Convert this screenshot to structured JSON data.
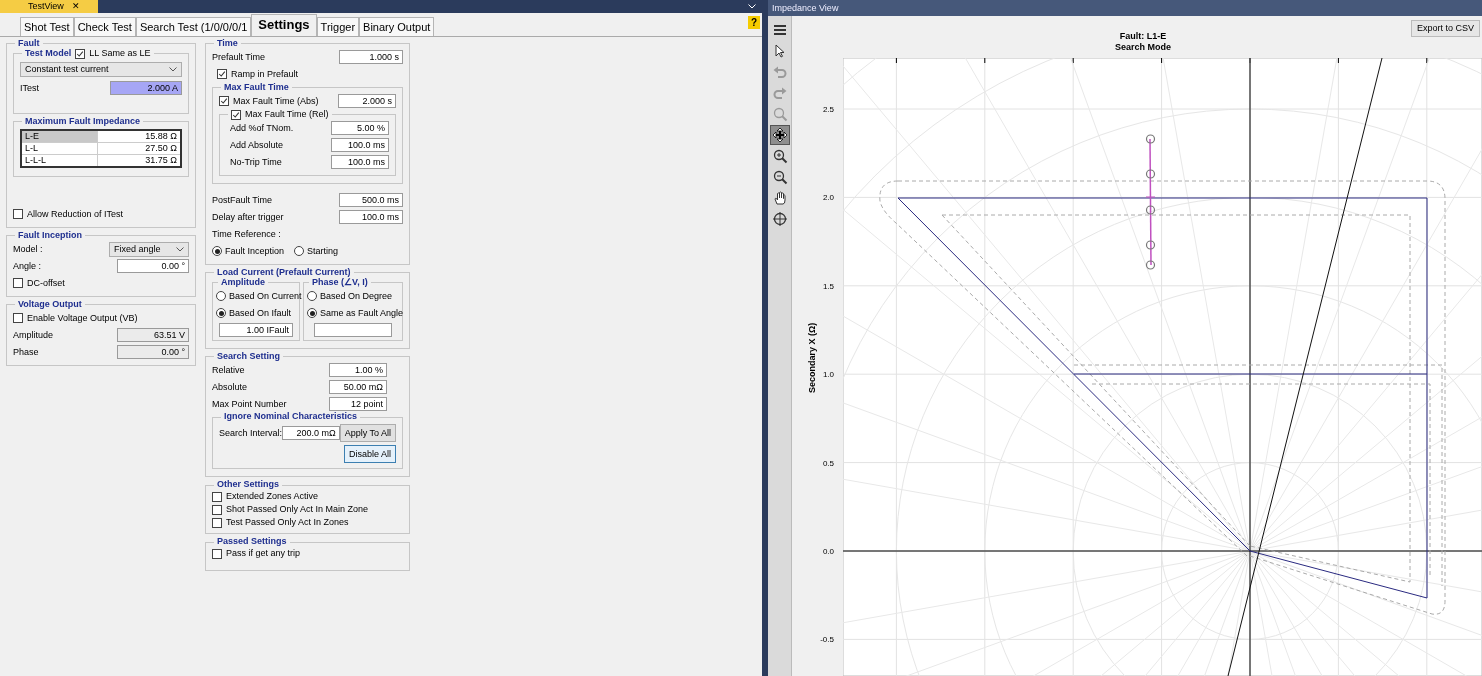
{
  "document_tab": {
    "title": "TestView",
    "close": "✕"
  },
  "tabs": [
    {
      "label": "Shot Test",
      "selected": false
    },
    {
      "label": "Check Test",
      "selected": false
    },
    {
      "label": "Search Test (1/0/0/0/1",
      "selected": false
    },
    {
      "label": "Settings",
      "selected": true
    },
    {
      "label": "Trigger",
      "selected": false
    },
    {
      "label": "Binary Output",
      "selected": false
    }
  ],
  "help": "?",
  "fault": {
    "title": "Fault",
    "test_model": {
      "title": "Test Model",
      "ll_same_as_le": {
        "label": "LL Same as LE",
        "checked": true
      },
      "mode": "Constant test current",
      "itest_label": "ITest",
      "itest": {
        "value": "2.000 A",
        "highlighted": true
      }
    },
    "max_impedance": {
      "title": "Maximum Fault Impedance",
      "rows": [
        {
          "loop": "L-E",
          "value": "15.88 Ω",
          "selected": true
        },
        {
          "loop": "L-L",
          "value": "27.50 Ω",
          "selected": false
        },
        {
          "loop": "L-L-L",
          "value": "31.75 Ω",
          "selected": false
        }
      ]
    },
    "allow_reduction": {
      "label": "Allow Reduction of ITest",
      "checked": false
    }
  },
  "fault_inception": {
    "title": "Fault Inception",
    "model_label": "Model :",
    "model_value": "Fixed angle",
    "angle_label": "Angle :",
    "angle": {
      "value": "0.00 °"
    },
    "dc_offset": {
      "label": "DC-offset",
      "checked": false
    }
  },
  "voltage_output": {
    "title": "Voltage Output",
    "enable": {
      "label": "Enable Voltage Output (VB)",
      "checked": false
    },
    "fields": [
      {
        "label": "Amplitude",
        "value": "63.51 V",
        "disabled": true
      },
      {
        "label": "Phase",
        "value": "0.00 °",
        "disabled": true
      }
    ]
  },
  "time": {
    "title": "Time",
    "prefault": {
      "label": "Prefault Time",
      "value": "1.000 s"
    },
    "ramp": {
      "label": "Ramp in Prefault",
      "checked": true
    },
    "max_fault": {
      "title": "Max Fault Time",
      "abs": {
        "label": "Max Fault Time (Abs)",
        "checked": true,
        "value": "2.000 s"
      },
      "rel": {
        "label": "Max Fault Time (Rel)",
        "checked": true,
        "fields": [
          {
            "label": "Add %of TNom.",
            "value": "5.00 %"
          },
          {
            "label": "Add Absolute",
            "value": "100.0 ms"
          },
          {
            "label": "No-Trip Time",
            "value": "100.0 ms"
          }
        ]
      }
    },
    "fields": [
      {
        "label": "PostFault Time",
        "value": "500.0 ms"
      },
      {
        "label": "Delay after trigger",
        "value": "100.0 ms"
      }
    ],
    "reference": {
      "label": "Time Reference :",
      "options": [
        {
          "label": "Fault Inception",
          "selected": true
        },
        {
          "label": "Starting",
          "selected": false
        }
      ]
    }
  },
  "load_current": {
    "title": "Load Current (Prefault Current)",
    "amplitude": {
      "title": "Amplitude",
      "options": [
        {
          "label": "Based On Current",
          "selected": false
        },
        {
          "label": "Based On Ifault",
          "selected": true
        }
      ],
      "value": "1.00 IFault"
    },
    "phase": {
      "title": "Phase (∠V, I)",
      "options": [
        {
          "label": "Based On Degree",
          "selected": false
        },
        {
          "label": "Same as Fault Angle",
          "selected": true
        }
      ]
    }
  },
  "search_setting": {
    "title": "Search Setting",
    "fields": [
      {
        "label": "Relative",
        "value": "1.00 %"
      },
      {
        "label": "Absolute",
        "value": "50.00 mΩ"
      },
      {
        "label": "Max Point Number",
        "value": "12 point"
      }
    ],
    "ignore": {
      "title": "Ignore Nominal Characteristics",
      "interval_label": "Search Interval:",
      "interval_value": "200.0 mΩ",
      "buttons": [
        {
          "label": "Apply To All",
          "focused": false
        },
        {
          "label": "Disable All",
          "focused": true
        }
      ]
    }
  },
  "other_settings": {
    "title": "Other Settings",
    "options": [
      {
        "label": "Extended Zones Active",
        "checked": false
      },
      {
        "label": "Shot Passed Only Act In Main Zone",
        "checked": false
      },
      {
        "label": "Test Passed Only Act In Zones",
        "checked": false
      }
    ]
  },
  "passed_settings": {
    "title": "Passed Settings",
    "options": [
      {
        "label": "Pass if get any trip",
        "checked": false
      }
    ]
  },
  "impedance_view": {
    "title": "Impedance View",
    "export": "Export to CSV",
    "toolbar": [
      {
        "kind": "menu",
        "selected": false,
        "disabled": false
      },
      {
        "kind": "pointer",
        "selected": false,
        "disabled": false
      },
      {
        "kind": "undo",
        "selected": false,
        "disabled": true
      },
      {
        "kind": "redo",
        "selected": false,
        "disabled": true
      },
      {
        "kind": "zoom",
        "selected": false,
        "disabled": true
      },
      {
        "kind": "move",
        "selected": true,
        "disabled": false
      },
      {
        "kind": "zoom-in",
        "selected": false,
        "disabled": false
      },
      {
        "kind": "zoom-out",
        "selected": false,
        "disabled": false
      },
      {
        "kind": "hand",
        "selected": false,
        "disabled": false
      },
      {
        "kind": "crosshair",
        "selected": false,
        "disabled": false
      }
    ],
    "plot": {
      "title": "Fault: L1-E",
      "subtitle": "Search Mode",
      "ylabel": "Secondary X (Ω)",
      "ytick_labels": [
        "2.5",
        "2.0",
        "1.5",
        "1.0",
        "0.5",
        "0.0",
        "-0.5"
      ]
    }
  }
}
